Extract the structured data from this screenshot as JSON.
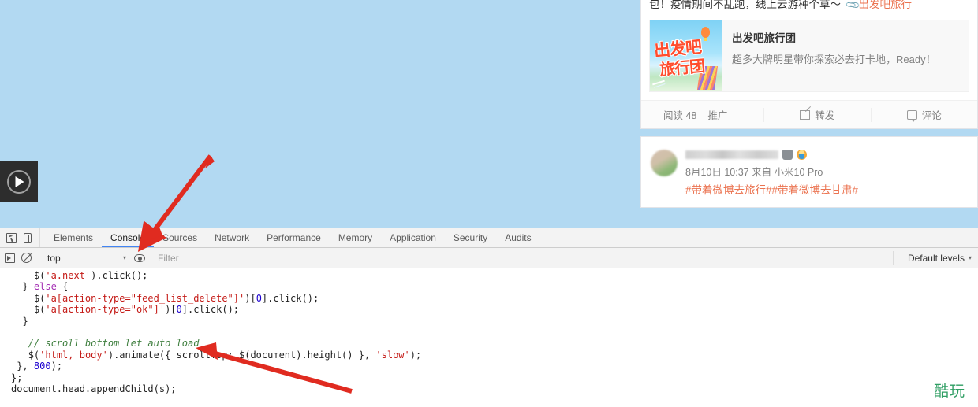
{
  "page": {
    "background_color": "#b2d9f2",
    "video": {
      "play_icon": "play-icon"
    },
    "weibo": {
      "post": {
        "text_prefix": "包！疫情期间不乱跑，线上云游种个草～",
        "link_icon": "paperclip-icon",
        "link_text": "出发吧旅行",
        "media_card": {
          "thumb_line1": "出发吧",
          "thumb_line2": "旅行团",
          "title": "出发吧旅行团",
          "description": "超多大牌明星带你探索必去打卡地，Ready！"
        },
        "actions": {
          "read_label": "阅读 48",
          "promote_label": "推广",
          "forward_icon": "forward-icon",
          "forward_label": "转发",
          "comment_icon": "comment-icon",
          "comment_label": "评论"
        }
      },
      "repost": {
        "avatar": "avatar",
        "badge_primary": "vip-badge-icon",
        "badge_secondary": "medal-badge-icon",
        "meta": "8月10日 10:37 来自 小米10 Pro",
        "hashtags": "#带着微博去旅行##带着微博去甘肃#"
      }
    }
  },
  "devtools": {
    "toolbar": {
      "inspect_icon": "inspect-element-icon",
      "device_icon": "device-toolbar-icon"
    },
    "tabs": [
      {
        "label": "Elements",
        "active": false
      },
      {
        "label": "Console",
        "active": true
      },
      {
        "label": "Sources",
        "active": false
      },
      {
        "label": "Network",
        "active": false
      },
      {
        "label": "Performance",
        "active": false
      },
      {
        "label": "Memory",
        "active": false
      },
      {
        "label": "Application",
        "active": false
      },
      {
        "label": "Security",
        "active": false
      },
      {
        "label": "Audits",
        "active": false
      }
    ],
    "filterbar": {
      "execute_icon": "execute-snippet-icon",
      "clear_icon": "clear-console-icon",
      "context": "top",
      "context_caret": "▾",
      "eye_icon": "live-expression-icon",
      "filter_value": "",
      "filter_placeholder": "Filter",
      "levels_label": "Default levels",
      "levels_caret": "▾"
    },
    "console_code": {
      "lines": [
        {
          "indent": 4,
          "tokens": [
            {
              "t": "$(",
              "c": ""
            },
            {
              "t": "'a.next'",
              "c": "str"
            },
            {
              "t": ").click();",
              "c": ""
            }
          ]
        },
        {
          "indent": 2,
          "tokens": [
            {
              "t": "} ",
              "c": ""
            },
            {
              "t": "else",
              "c": "kw"
            },
            {
              "t": " {",
              "c": ""
            }
          ]
        },
        {
          "indent": 4,
          "tokens": [
            {
              "t": "$(",
              "c": ""
            },
            {
              "t": "'a[action-type=\"feed_list_delete\"]'",
              "c": "str"
            },
            {
              "t": ")[",
              "c": ""
            },
            {
              "t": "0",
              "c": "num"
            },
            {
              "t": "].click();",
              "c": ""
            }
          ]
        },
        {
          "indent": 4,
          "tokens": [
            {
              "t": "$(",
              "c": ""
            },
            {
              "t": "'a[action-type=\"ok\"]'",
              "c": "str"
            },
            {
              "t": ")[",
              "c": ""
            },
            {
              "t": "0",
              "c": "num"
            },
            {
              "t": "].click();",
              "c": ""
            }
          ]
        },
        {
          "indent": 2,
          "tokens": [
            {
              "t": "}",
              "c": ""
            }
          ]
        },
        {
          "indent": 0,
          "tokens": []
        },
        {
          "indent": 3,
          "tokens": [
            {
              "t": "// scroll bottom let auto load",
              "c": "cmt"
            }
          ]
        },
        {
          "indent": 3,
          "tokens": [
            {
              "t": "$(",
              "c": ""
            },
            {
              "t": "'html, body'",
              "c": "str"
            },
            {
              "t": ").animate({ scrollTop: $(document).height() }, ",
              "c": ""
            },
            {
              "t": "'slow'",
              "c": "str"
            },
            {
              "t": ");",
              "c": ""
            }
          ]
        },
        {
          "indent": 1,
          "tokens": [
            {
              "t": "}, ",
              "c": ""
            },
            {
              "t": "800",
              "c": "num"
            },
            {
              "t": ");",
              "c": ""
            }
          ]
        },
        {
          "indent": 0,
          "tokens": [
            {
              "t": "};",
              "c": ""
            }
          ]
        },
        {
          "indent": 0,
          "tokens": [
            {
              "t": "document.head.appendChild(s);",
              "c": ""
            }
          ]
        }
      ]
    }
  },
  "annotations": {
    "arrow_color": "#e02b20",
    "arrow_to_console_tab": "arrow-pointing-to-console-tab",
    "arrow_to_code_line": "arrow-pointing-to-scroll-line"
  },
  "watermark": {
    "text": "酷玩",
    "color": "#2f9e63"
  }
}
